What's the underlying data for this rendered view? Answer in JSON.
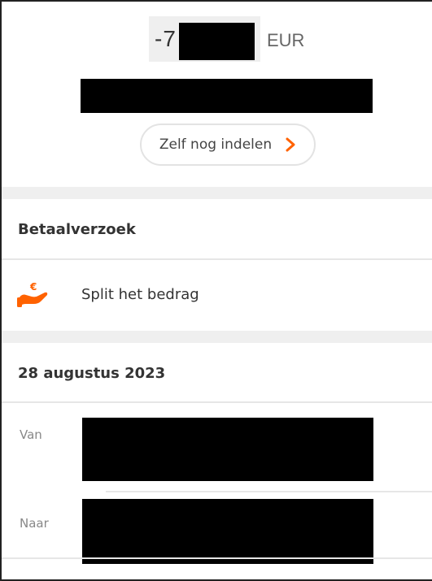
{
  "header": {
    "amount_sign": "-7",
    "currency": "EUR",
    "categorize_button": "Zelf nog indelen"
  },
  "sections": {
    "payment_request_title": "Betaalverzoek",
    "split_label": "Split het bedrag",
    "date_title": "28 augustus 2023"
  },
  "details": {
    "from_label": "Van",
    "to_label": "Naar"
  },
  "colors": {
    "accent": "#ff6200",
    "band": "#efefef",
    "redaction": "#000000"
  },
  "icons": {
    "split": "split-payment-icon",
    "chevron": "chevron-right-icon"
  }
}
